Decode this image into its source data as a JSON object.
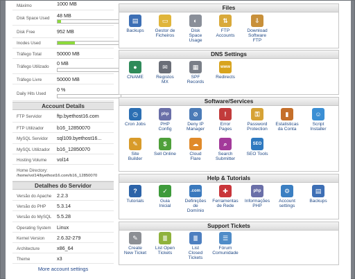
{
  "sidebar": {
    "stats": [
      {
        "label": "Máximo",
        "value": "1000 MB"
      },
      {
        "label": "Disk Space Used",
        "value": "48 MB",
        "bar": 0.05
      },
      {
        "label": "Disk Free",
        "value": "952 MB"
      },
      {
        "label": "Inodes Used",
        "value": "",
        "bar": 0.28
      },
      {
        "label": "Tráfego Total",
        "value": "50000 MB"
      },
      {
        "label": "Tráfego Utilizado",
        "value": "0 MB",
        "bar": 0
      },
      {
        "label": "Tráfego Livre",
        "value": "50000 MB"
      },
      {
        "label": "Daily Hits Used",
        "value": "0 %",
        "bar": 0
      }
    ],
    "account_details_title": "Account Details",
    "account_details": [
      {
        "label": "FTP Servidor",
        "value": "ftp.byethost16.com"
      },
      {
        "label": "FTP Utilizador",
        "value": "b16_12850070"
      },
      {
        "label": "MySQL Servidor",
        "value": "sql109.byethost16..."
      },
      {
        "label": "MySQL Utilizador",
        "value": "b16_12850070"
      },
      {
        "label": "Hosting Volume",
        "value": "vol14"
      }
    ],
    "home_directory_label": "Home Directory:",
    "home_directory_value": "/home/vol14/byethost16.com/b16_12850070",
    "server_details_title": "Detalhes do Servidor",
    "server_details": [
      {
        "label": "Versão do Apache",
        "value": "2.2.3"
      },
      {
        "label": "Versão do PHP",
        "value": "5.3.14"
      },
      {
        "label": "Versão do MySQL",
        "value": "5.5.28"
      },
      {
        "label": "Operating System",
        "value": "Linux"
      },
      {
        "label": "Kernel Version",
        "value": "2.6.32-279"
      },
      {
        "label": "Architecture",
        "value": "x86_64"
      },
      {
        "label": "Theme",
        "value": "x3"
      }
    ],
    "more_link": "More account settings"
  },
  "panels": [
    {
      "title": "Files",
      "items": [
        {
          "label": "Backups",
          "icon": "backups-icon",
          "color": "#3d6fb5",
          "glyph": "▤"
        },
        {
          "label": "Gestor de\nFicheiros",
          "icon": "file-manager-icon",
          "color": "#e0b53a",
          "glyph": "▭"
        },
        {
          "label": "Disk\nSpace\nUsage",
          "icon": "disk-usage-icon",
          "color": "#8a8f99",
          "glyph": "◐"
        },
        {
          "label": "FTP\nAccounts",
          "icon": "ftp-accounts-icon",
          "color": "#d9a93a",
          "glyph": "⇅"
        },
        {
          "label": "Download\nSoftware\nFTP",
          "icon": "download-ftp-icon",
          "color": "#c8903a",
          "glyph": "⇩"
        }
      ]
    },
    {
      "title": "DNS Settings",
      "items": [
        {
          "label": "CNAME",
          "icon": "cname-icon",
          "color": "#2f8b5a",
          "glyph": "●"
        },
        {
          "label": "Registos\nMX",
          "icon": "mx-records-icon",
          "color": "#6a6e77",
          "glyph": "✉"
        },
        {
          "label": "SPF\nRecords",
          "icon": "spf-records-icon",
          "color": "#7a7f88",
          "glyph": "▦"
        },
        {
          "label": "Redirects",
          "icon": "redirects-icon",
          "color": "#d8a41e",
          "glyph": "www"
        }
      ]
    },
    {
      "title": "Software/Services",
      "items": [
        {
          "label": "Cron Jobs",
          "icon": "cron-jobs-icon",
          "color": "#2c6fb3",
          "glyph": "◷"
        },
        {
          "label": "PHP\nConfig",
          "icon": "php-config-icon",
          "color": "#6a6fa8",
          "glyph": "php"
        },
        {
          "label": "Deny IP\nManager",
          "icon": "deny-ip-icon",
          "color": "#4b7bb7",
          "glyph": "⊘"
        },
        {
          "label": "Error\nPages",
          "icon": "error-pages-icon",
          "color": "#c23b3b",
          "glyph": "!"
        },
        {
          "label": "Password\nProtection",
          "icon": "password-protection-icon",
          "color": "#d6a235",
          "glyph": "⚿"
        },
        {
          "label": "Estatisticas\nda Conta",
          "icon": "statistics-icon",
          "color": "#c56f2a",
          "glyph": "▮"
        },
        {
          "label": "Script\nInstaller",
          "icon": "script-installer-icon",
          "color": "#3b8fd4",
          "glyph": "☺"
        },
        {
          "label": "Site\nBuilder",
          "icon": "site-builder-icon",
          "color": "#d89b2a",
          "glyph": "✎"
        },
        {
          "label": "Sell Online",
          "icon": "sell-online-icon",
          "color": "#4fa03a",
          "glyph": "$"
        },
        {
          "label": "Cloud\nFlare",
          "icon": "cloudflare-icon",
          "color": "#e08a2a",
          "glyph": "☁"
        },
        {
          "label": "Search\nSubmitter",
          "icon": "search-submitter-icon",
          "color": "#a33a9a",
          "glyph": "⌕"
        },
        {
          "label": "SEO Tools",
          "icon": "seo-tools-icon",
          "color": "#2f7ac0",
          "glyph": "SEO"
        }
      ]
    },
    {
      "title": "Help & Tutorials",
      "items": [
        {
          "label": "Tutorials",
          "icon": "tutorials-icon",
          "color": "#2c63a8",
          "glyph": "?"
        },
        {
          "label": "Guia\nInicial",
          "icon": "getting-started-icon",
          "color": "#3d9a3a",
          "glyph": "✓"
        },
        {
          "label": "Definições\nde\nDomínio",
          "icon": "domain-settings-icon",
          "color": "#3a79bd",
          "glyph": ".com"
        },
        {
          "label": "Ferramentas\nde Rede",
          "icon": "network-tools-icon",
          "color": "#c9353a",
          "glyph": "✚"
        },
        {
          "label": "Informações\nPHP",
          "icon": "php-info-icon",
          "color": "#6a6fa8",
          "glyph": "php"
        },
        {
          "label": "Account\nsettings",
          "icon": "account-settings-icon",
          "color": "#3b7fc2",
          "glyph": "⚙"
        },
        {
          "label": "Backups",
          "icon": "backups-icon",
          "color": "#3d6fb5",
          "glyph": "▤"
        }
      ]
    },
    {
      "title": "Support Tickets",
      "items": [
        {
          "label": "Create\nNew Ticket",
          "icon": "create-ticket-icon",
          "color": "#8c8f94",
          "glyph": "✎"
        },
        {
          "label": "List Open\nTickets",
          "icon": "list-open-tickets-icon",
          "color": "#8fb23c",
          "glyph": "≣"
        },
        {
          "label": "List\nClosed\nTickets",
          "icon": "list-closed-tickets-icon",
          "color": "#4d7fc0",
          "glyph": "≣"
        },
        {
          "label": "Fórum\nComunidade",
          "icon": "forum-icon",
          "color": "#4f8cc8",
          "glyph": "☰"
        }
      ]
    }
  ]
}
